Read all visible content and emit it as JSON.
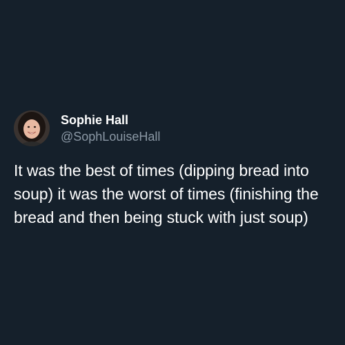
{
  "theme": {
    "background": "#15202b",
    "name_color": "#ffffff",
    "handle_color": "#8b98a5",
    "text_color": "#ffffff"
  },
  "tweet": {
    "display_name": "Sophie Hall",
    "handle": "@SophLouiseHall",
    "avatar": "user-avatar-photo",
    "text": "It was the best of times (dipping bread into soup) it was the worst of times (finishing the bread and then being stuck with just soup)"
  }
}
